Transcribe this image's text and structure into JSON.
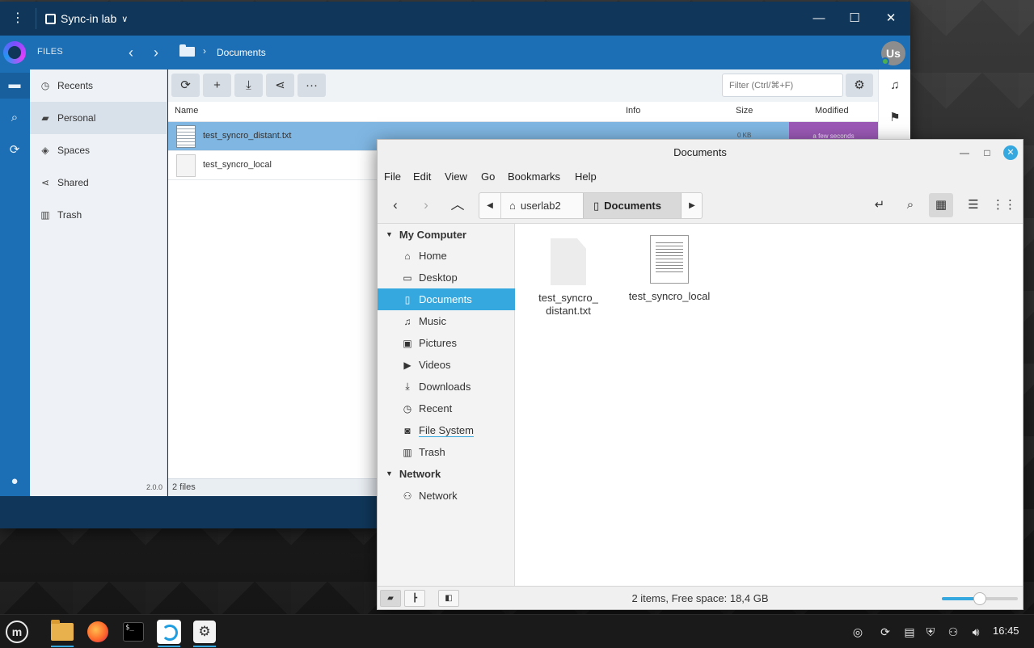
{
  "sync_window": {
    "app_title": "Sync-in lab",
    "section_label": "FILES",
    "breadcrumb": "Documents",
    "avatar_initials": "Us",
    "sidebar": {
      "items": [
        {
          "label": "Recents"
        },
        {
          "label": "Personal"
        },
        {
          "label": "Spaces"
        },
        {
          "label": "Shared"
        },
        {
          "label": "Trash"
        }
      ],
      "version": "2.0.0"
    },
    "filter": {
      "placeholder": "Filter (Ctrl/⌘+F)"
    },
    "columns": {
      "name": "Name",
      "info": "Info",
      "size": "Size",
      "modified": "Modified"
    },
    "files": [
      {
        "name": "test_syncro_distant.txt",
        "size": "0 KB",
        "modified": "a few seconds"
      },
      {
        "name": "test_syncro_local"
      }
    ],
    "status": "2 files"
  },
  "nemo_window": {
    "title": "Documents",
    "menu": [
      "File",
      "Edit",
      "View",
      "Go",
      "Bookmarks",
      "Help"
    ],
    "path": {
      "home": "userlab2",
      "current": "Documents"
    },
    "places": {
      "my_computer_header": "My Computer",
      "my_computer": [
        "Home",
        "Desktop",
        "Documents",
        "Music",
        "Pictures",
        "Videos",
        "Downloads",
        "Recent",
        "File System",
        "Trash"
      ],
      "network_header": "Network",
      "network": [
        "Network"
      ],
      "active": "Documents"
    },
    "items": [
      {
        "name": "test_syncro_\ndistant.txt",
        "icon": "blank-file-icon"
      },
      {
        "name": "test_syncro_local",
        "icon": "text-file-icon"
      }
    ],
    "status": "2 items, Free space: 18,4 GB",
    "zoom_level": 0.5
  },
  "taskbar": {
    "clock": "16:45"
  },
  "colors": {
    "sync_header": "#1c6fb5",
    "sync_titlebar": "#10375a",
    "selected_row": "#7fb6e2",
    "modified_badge": "#9b59b6",
    "nemo_accent": "#35a8e0"
  }
}
